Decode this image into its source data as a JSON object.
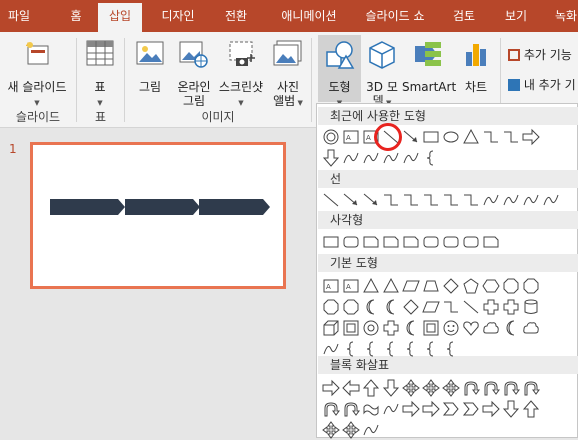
{
  "tabs": [
    "파일",
    "홈",
    "삽입",
    "디자인",
    "전환",
    "애니메이션",
    "슬라이드 쇼",
    "검토",
    "보기",
    "녹화"
  ],
  "ribbon": {
    "new_slide": "새 슬라이드",
    "table": "표",
    "picture": "그림",
    "online_picture_1": "온라인",
    "online_picture_2": "그림",
    "screenshot": "스크린샷",
    "album_1": "사진",
    "album_2": "앨범",
    "shapes": "도형",
    "model_1": "3D 모",
    "model_2": "델",
    "smartart": "SmartArt",
    "chart": "차트",
    "addins_1": "추가 기능",
    "addins_2": "내 추가 기",
    "groups": {
      "slides": "슬라이드",
      "tables": "표",
      "images": "이미지"
    }
  },
  "slide_number": "1",
  "shapes_menu": {
    "sections": [
      "최근에 사용한 도형",
      "선",
      "사각형",
      "기본 도형",
      "블록 화살표"
    ]
  },
  "colors": {
    "accent": "#b7472a",
    "slide_border": "#e97451",
    "arrow_fill": "#2f3b4c"
  }
}
